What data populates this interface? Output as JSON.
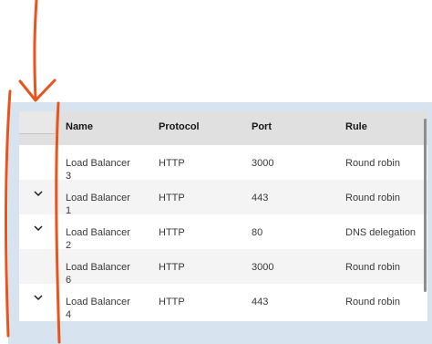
{
  "table": {
    "headers": [
      "Name",
      "Protocol",
      "Port",
      "Rule"
    ],
    "rows": [
      {
        "name": "Load Balancer 3",
        "protocol": "HTTP",
        "port": "3000",
        "rule": "Round robin",
        "expandable": false
      },
      {
        "name": "Load Balancer 1",
        "protocol": "HTTP",
        "port": "443",
        "rule": "Round robin",
        "expandable": true
      },
      {
        "name": "Load Balancer 2",
        "protocol": "HTTP",
        "port": "80",
        "rule": "DNS delegation",
        "expandable": true
      },
      {
        "name": "Load Balancer 6",
        "protocol": "HTTP",
        "port": "3000",
        "rule": "Round robin",
        "expandable": false
      },
      {
        "name": "Load Balancer 4",
        "protocol": "HTTP",
        "port": "443",
        "rule": "Round robin",
        "expandable": true
      }
    ]
  },
  "colors": {
    "annotation": "#e8541c",
    "header_bg": "#e0e0e0",
    "zebra_bg": "#f4f4f4",
    "frame_bg": "#d7e3ee"
  },
  "icons": {
    "expand": "chevron-down-icon",
    "annotation": "hand-drawn-arrow"
  }
}
